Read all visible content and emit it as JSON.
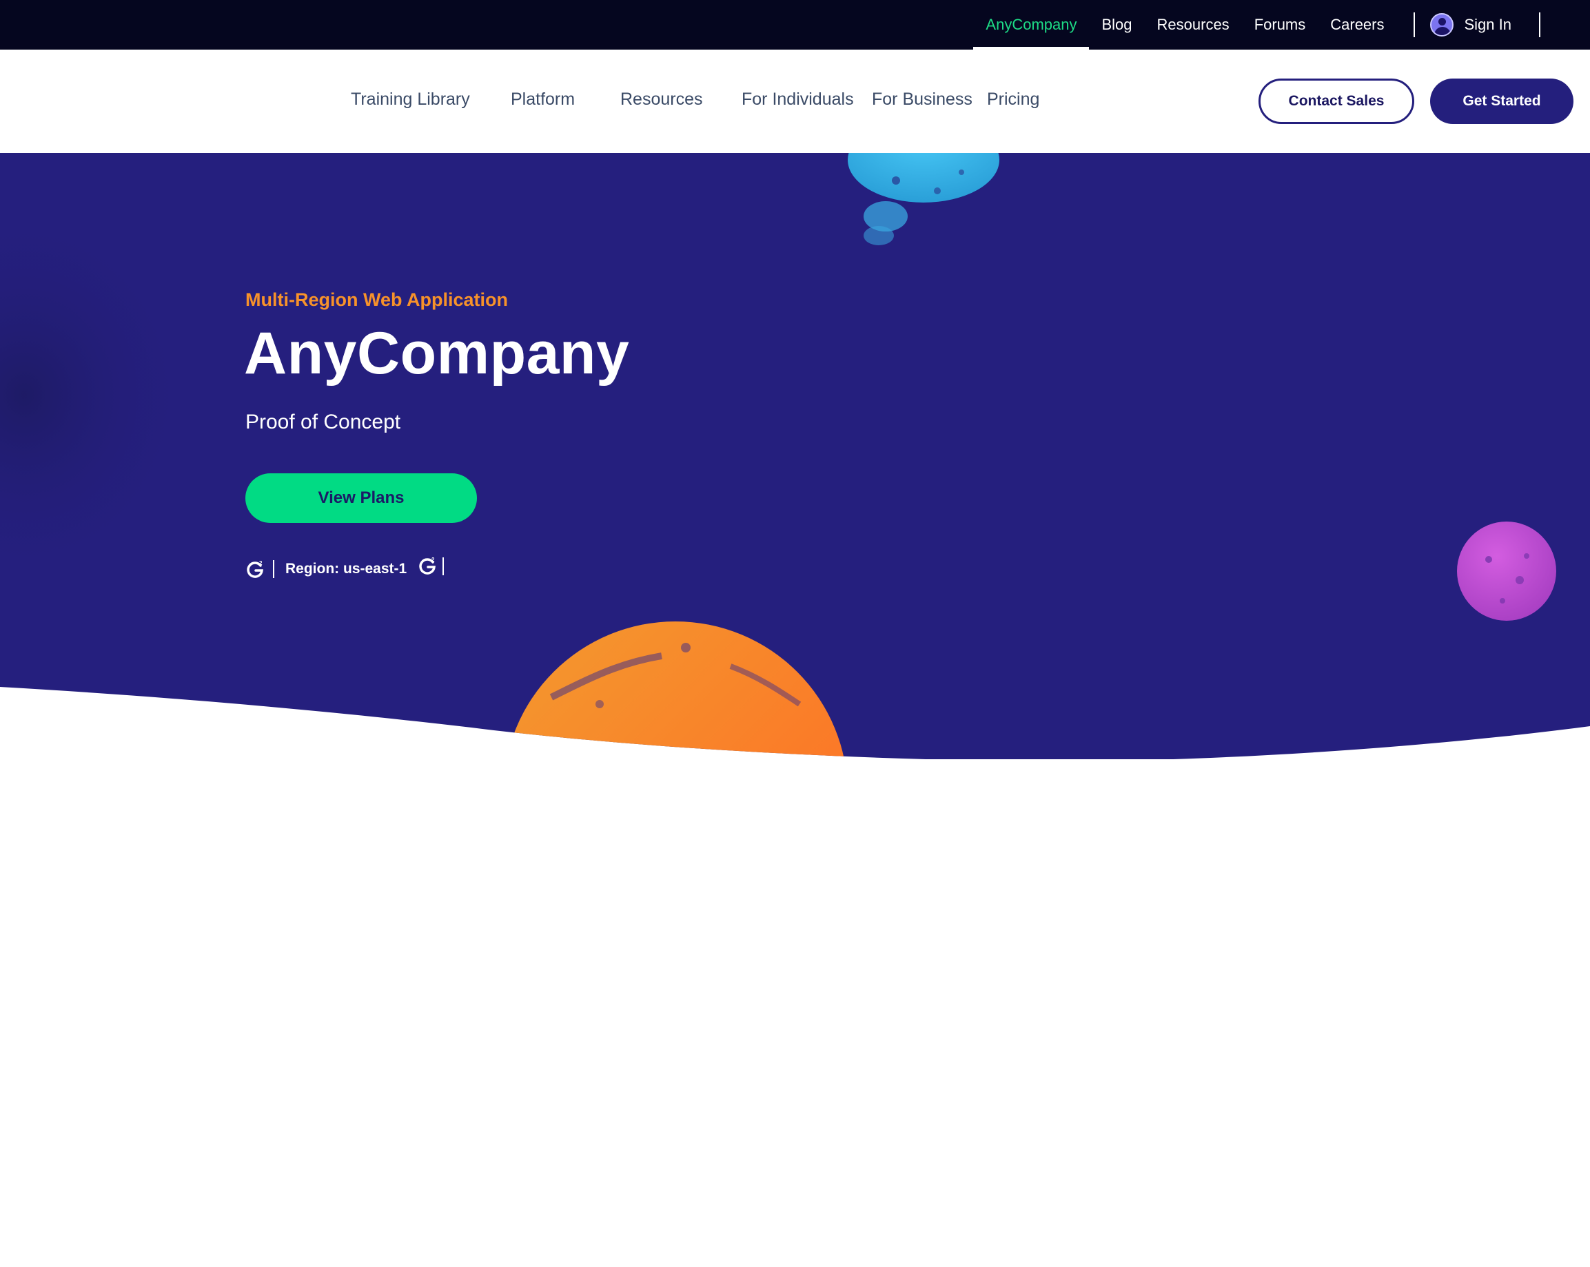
{
  "topbar": {
    "links": [
      {
        "label": "AnyCompany",
        "active": true
      },
      {
        "label": "Blog",
        "active": false
      },
      {
        "label": "Resources",
        "active": false
      },
      {
        "label": "Forums",
        "active": false
      },
      {
        "label": "Careers",
        "active": false
      }
    ],
    "signin_label": "Sign In"
  },
  "mainnav": {
    "links": [
      "Training Library",
      "Platform",
      "Resources",
      "For Individuals",
      "For Business",
      "Pricing"
    ],
    "contact_sales": "Contact Sales",
    "get_started": "Get Started"
  },
  "hero": {
    "eyebrow": "Multi-Region Web Application",
    "title": "AnyCompany",
    "subtitle": "Proof of Concept",
    "cta": "View Plans",
    "region_label": "Region: us-east-1"
  },
  "colors": {
    "topbar_bg": "#05061f",
    "active_link": "#1ddc86",
    "hero_bg": "#251f7e",
    "eyebrow": "#f7922a",
    "cta_bg": "#01db84",
    "brand_dark": "#241f7d"
  },
  "icons": {
    "avatar": "user-avatar-icon",
    "review_badge": "g2-icon"
  }
}
